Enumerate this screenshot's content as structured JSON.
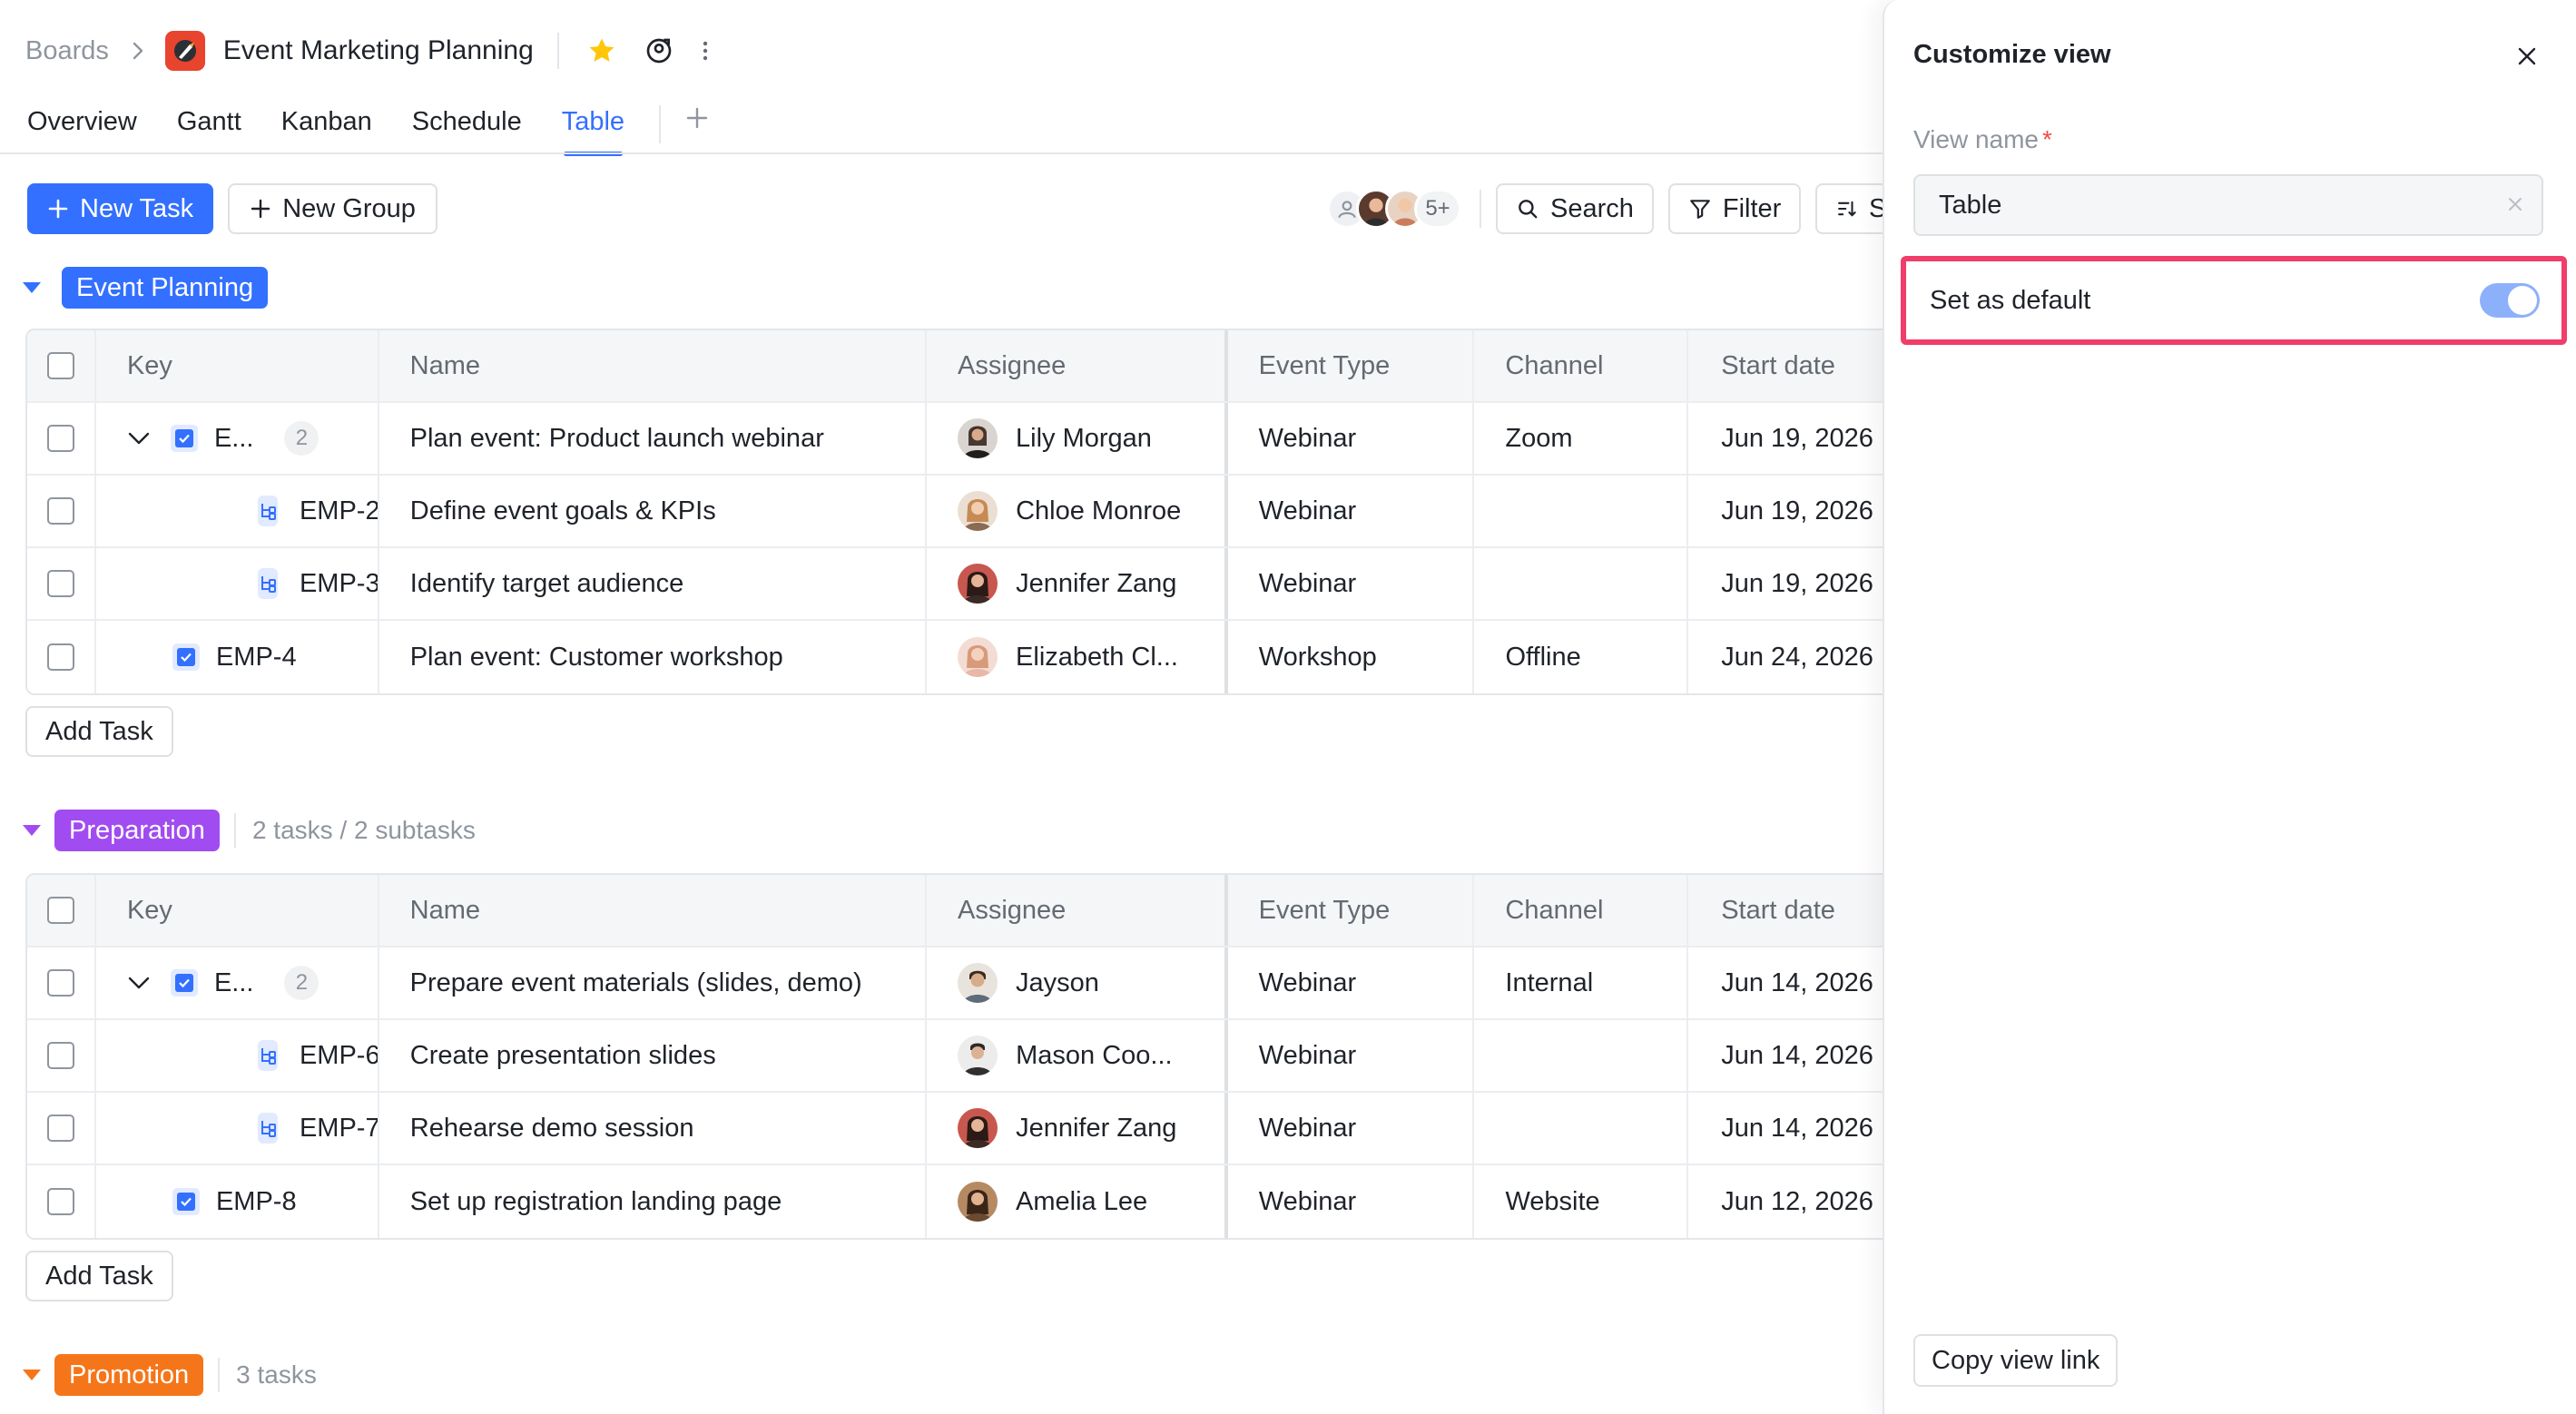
{
  "header": {
    "breadcrumb_root": "Boards",
    "board_title": "Event Marketing Planning",
    "icons": [
      "chevron-right-icon",
      "board-logo-icon",
      "star-icon",
      "share-icon",
      "more-icon"
    ]
  },
  "tabs": [
    {
      "label": "Overview",
      "active": false
    },
    {
      "label": "Gantt",
      "active": false
    },
    {
      "label": "Kanban",
      "active": false
    },
    {
      "label": "Schedule",
      "active": false
    },
    {
      "label": "Table",
      "active": true
    }
  ],
  "toolbar": {
    "new_task": "New Task",
    "new_group": "New Group",
    "members_more": "5+",
    "search": "Search",
    "filter": "Filter",
    "sort_partial": "S"
  },
  "columns": [
    "Key",
    "Name",
    "Assignee",
    "Event Type",
    "Channel",
    "Start date"
  ],
  "groups": [
    {
      "name": "Event Planning",
      "meta": "",
      "color": "#3370ff",
      "add_task": "Add Task",
      "rows": [
        {
          "level": "parent",
          "key": "E...",
          "subcount": "2",
          "name": "Plan event: Product launch webinar",
          "assignee": "Lily Morgan",
          "type": "Webinar",
          "channel": "Zoom",
          "start": "Jun 19, 2026"
        },
        {
          "level": "sub",
          "key": "EMP-2",
          "name": "Define event goals & KPIs",
          "assignee": "Chloe Monroe",
          "type": "Webinar",
          "channel": "",
          "start": "Jun 19, 2026"
        },
        {
          "level": "sub",
          "key": "EMP-3",
          "name": "Identify target audience",
          "assignee": "Jennifer Zang",
          "type": "Webinar",
          "channel": "",
          "start": "Jun 19, 2026"
        },
        {
          "level": "task",
          "key": "EMP-4",
          "name": "Plan event: Customer workshop",
          "assignee": "Elizabeth Cl...",
          "type": "Workshop",
          "channel": "Offline",
          "start": "Jun 24, 2026"
        }
      ]
    },
    {
      "name": "Preparation",
      "meta": "2 tasks / 2 subtasks",
      "color": "#a14cf0",
      "add_task": "Add Task",
      "rows": [
        {
          "level": "parent",
          "key": "E...",
          "subcount": "2",
          "name": "Prepare event materials (slides, demo)",
          "assignee": "Jayson",
          "type": "Webinar",
          "channel": "Internal",
          "start": "Jun 14, 2026"
        },
        {
          "level": "sub",
          "key": "EMP-6",
          "name": "Create presentation slides",
          "assignee": "Mason Coo...",
          "type": "Webinar",
          "channel": "",
          "start": "Jun 14, 2026"
        },
        {
          "level": "sub",
          "key": "EMP-7",
          "name": "Rehearse demo session",
          "assignee": "Jennifer Zang",
          "type": "Webinar",
          "channel": "",
          "start": "Jun 14, 2026"
        },
        {
          "level": "task",
          "key": "EMP-8",
          "name": "Set up registration landing page",
          "assignee": "Amelia Lee",
          "type": "Webinar",
          "channel": "Website",
          "start": "Jun 12, 2026"
        }
      ]
    },
    {
      "name": "Promotion",
      "meta": "3 tasks",
      "color": "#f5761a",
      "add_task": "",
      "rows": []
    }
  ],
  "panel": {
    "title": "Customize view",
    "view_name_label": "View name",
    "required_mark": "*",
    "view_name_value": "Table",
    "set_default_label": "Set as default",
    "set_default_on": true,
    "copy_link": "Copy view link"
  },
  "colors": {
    "accent": "#3370ff",
    "highlight_border": "#f03d6a",
    "toggle_on": "#8db0fb"
  }
}
